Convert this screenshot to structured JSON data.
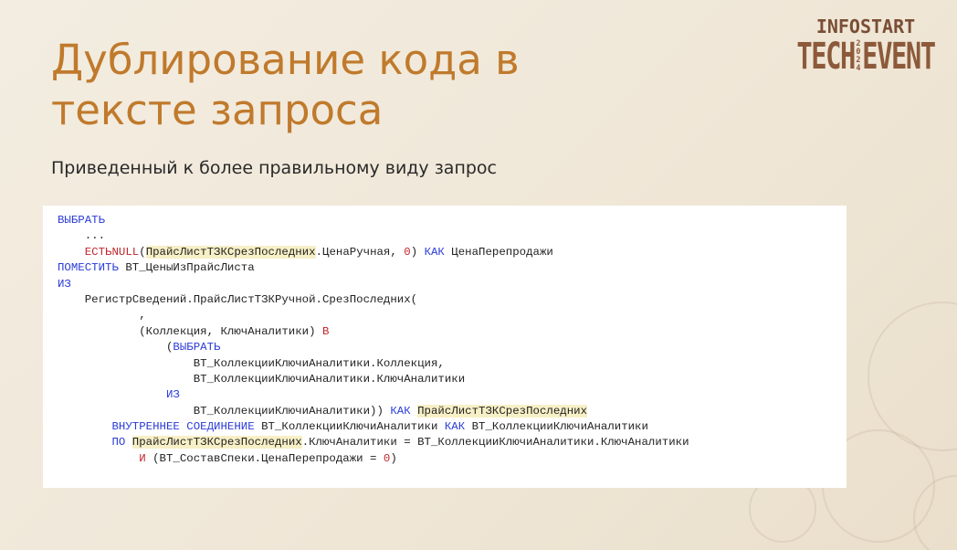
{
  "slide": {
    "title_line1": "Дублирование кода в",
    "title_line2": "тексте запроса",
    "subtitle": "Приведенный к более правильному виду запрос"
  },
  "logo": {
    "top": "INFOSTART",
    "left": "TECH",
    "right": "EVENT",
    "year": [
      "2",
      "0",
      "2",
      "4"
    ]
  },
  "code": {
    "lines": [
      "ВЫБРАТЬ",
      "    ...",
      "    ЕСТЬNULL(ПрайсЛистТЗКСрезПоследних.ЦенаРучная, 0) КАК ЦенаПерепродажи",
      "ПОМЕСТИТЬ ВТ_ЦеныИзПрайсЛиста",
      "ИЗ",
      "    РегистрСведений.ПрайсЛистТЗКРучной.СрезПоследних(",
      "            ,",
      "            (Коллекция, КлючАналитики) В",
      "                (ВЫБРАТЬ",
      "                    ВТ_КоллекцииКлючиАналитики.Коллекция,",
      "                    ВТ_КоллекцииКлючиАналитики.КлючАналитики",
      "                ИЗ",
      "                    ВТ_КоллекцииКлючиАналитики)) КАК ПрайсЛистТЗКСрезПоследних",
      "        ВНУТРЕННЕЕ СОЕДИНЕНИЕ ВТ_КоллекцииКлючиАналитики КАК ВТ_КоллекцииКлючиАналитики",
      "        ПО ПрайсЛистТЗКСрезПоследних.КлючАналитики = ВТ_КоллекцииКлючиАналитики.КлючАналитики",
      "            И (ВТ_СоставСпеки.ЦенаПерепродажи = 0)"
    ]
  },
  "colors": {
    "title": "#c07a2c",
    "keyword": "#2a3bd6",
    "function": "#c0262b",
    "highlight": "#f7efc6"
  }
}
